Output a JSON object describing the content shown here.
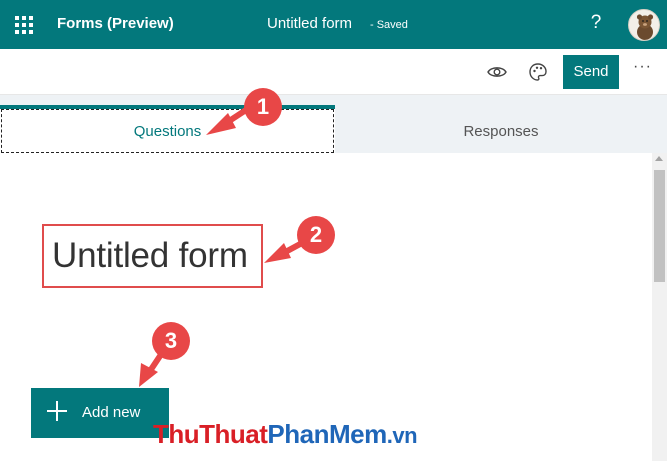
{
  "header": {
    "app_title": "Forms (Preview)",
    "doc_title": "Untitled form",
    "status": "- Saved",
    "help_icon": "question-mark-icon",
    "help_label": "?"
  },
  "toolbar": {
    "preview_icon": "eye-icon",
    "theme_icon": "palette-icon",
    "send_label": "Send",
    "more_label": "···"
  },
  "tabs": [
    {
      "label": "Questions",
      "selected": true
    },
    {
      "label": "Responses",
      "selected": false
    }
  ],
  "form": {
    "title": "Untitled form",
    "add_new_label": "Add new"
  },
  "annotations": [
    "1",
    "2",
    "3"
  ],
  "watermark": {
    "part1": "ThuThuat",
    "part2": "PhanMem",
    "part3": ".vn"
  },
  "colors": {
    "accent": "#03787c",
    "annotation": "#e84747",
    "watermark_red": "#d91f26",
    "watermark_blue": "#1f66b8"
  }
}
